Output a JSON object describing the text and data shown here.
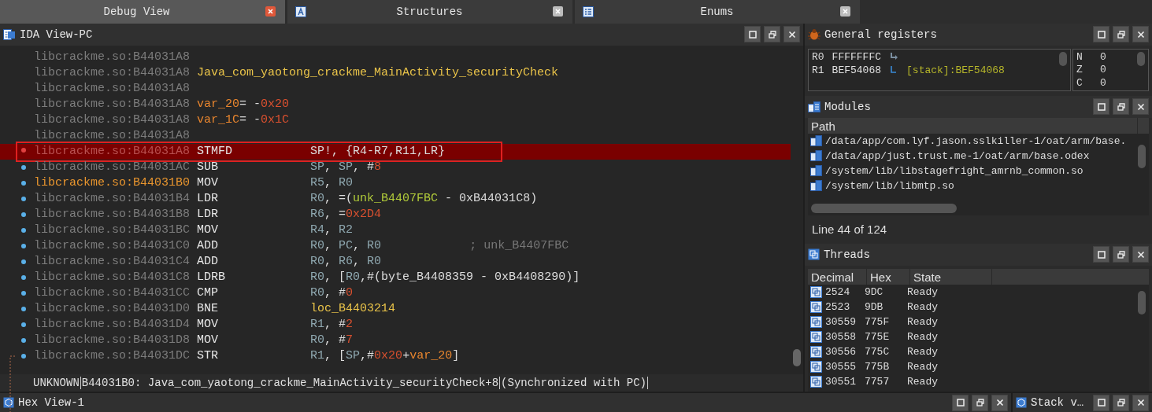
{
  "tabs": [
    {
      "label": "Debug View",
      "selected": true
    },
    {
      "label": "Structures",
      "selected": false
    },
    {
      "label": "Enums",
      "selected": false
    }
  ],
  "ida_view": {
    "title": "IDA View-PC",
    "lines": [
      {
        "address": "libcrackme.so:B44031A8",
        "is_label": false,
        "dot": false,
        "breakpoint": false,
        "highlighted": false,
        "boxed": false
      },
      {
        "address": "libcrackme.so:B44031A8",
        "is_label": false,
        "dot": false,
        "breakpoint": false,
        "highlighted": false,
        "boxed": false,
        "operands": [
          {
            "t": "Java_com_yaotong_crackme_MainActivity_securityCheck",
            "kind": "func"
          }
        ]
      },
      {
        "address": "libcrackme.so:B44031A8",
        "is_label": false,
        "dot": false,
        "breakpoint": false,
        "highlighted": false,
        "boxed": false
      },
      {
        "address": "libcrackme.so:B44031A8",
        "is_label": false,
        "dot": false,
        "breakpoint": false,
        "highlighted": false,
        "boxed": false,
        "operands": [
          {
            "t": "var_20",
            "kind": "var"
          },
          {
            "t": "= -",
            "kind": "punct"
          },
          {
            "t": "0x20",
            "kind": "num"
          }
        ]
      },
      {
        "address": "libcrackme.so:B44031A8",
        "is_label": false,
        "dot": false,
        "breakpoint": false,
        "highlighted": false,
        "boxed": false,
        "operands": [
          {
            "t": "var_1C",
            "kind": "var"
          },
          {
            "t": "= -",
            "kind": "punct"
          },
          {
            "t": "0x1C",
            "kind": "num"
          }
        ]
      },
      {
        "address": "libcrackme.so:B44031A8",
        "is_label": false,
        "dot": false,
        "breakpoint": false,
        "highlighted": false,
        "boxed": false
      },
      {
        "address": "libcrackme.so:B44031A8",
        "is_label": false,
        "dot": false,
        "breakpoint": true,
        "highlighted": true,
        "boxed": true,
        "mnemonic": "STMFD",
        "operands": [
          {
            "t": "SP!, {R4-R7,R11,LR}",
            "kind": "punct"
          }
        ]
      },
      {
        "address": "libcrackme.so:B44031AC",
        "is_label": false,
        "dot": true,
        "breakpoint": false,
        "highlighted": false,
        "boxed": false,
        "mnemonic": "SUB",
        "operands": [
          {
            "t": "SP",
            "kind": "reg"
          },
          {
            "t": ", ",
            "kind": "punct"
          },
          {
            "t": "SP",
            "kind": "reg"
          },
          {
            "t": ", #",
            "kind": "punct"
          },
          {
            "t": "8",
            "kind": "num"
          }
        ]
      },
      {
        "address": "libcrackme.so:B44031B0",
        "is_label": true,
        "dot": true,
        "breakpoint": false,
        "highlighted": false,
        "boxed": false,
        "mnemonic": "MOV",
        "operands": [
          {
            "t": "R5",
            "kind": "reg"
          },
          {
            "t": ", ",
            "kind": "punct"
          },
          {
            "t": "R0",
            "kind": "reg"
          }
        ]
      },
      {
        "address": "libcrackme.so:B44031B4",
        "is_label": false,
        "dot": true,
        "breakpoint": false,
        "highlighted": false,
        "boxed": false,
        "mnemonic": "LDR",
        "operands": [
          {
            "t": "R0",
            "kind": "reg"
          },
          {
            "t": ", =(",
            "kind": "punct"
          },
          {
            "t": "unk_B4407FBC",
            "kind": "sym"
          },
          {
            "t": " - 0xB44031C8)",
            "kind": "punct"
          }
        ]
      },
      {
        "address": "libcrackme.so:B44031B8",
        "is_label": false,
        "dot": true,
        "breakpoint": false,
        "highlighted": false,
        "boxed": false,
        "mnemonic": "LDR",
        "operands": [
          {
            "t": "R6",
            "kind": "reg"
          },
          {
            "t": ", =",
            "kind": "punct"
          },
          {
            "t": "0x2D4",
            "kind": "num"
          }
        ]
      },
      {
        "address": "libcrackme.so:B44031BC",
        "is_label": false,
        "dot": true,
        "breakpoint": false,
        "highlighted": false,
        "boxed": false,
        "mnemonic": "MOV",
        "operands": [
          {
            "t": "R4",
            "kind": "reg"
          },
          {
            "t": ", ",
            "kind": "punct"
          },
          {
            "t": "R2",
            "kind": "reg"
          }
        ]
      },
      {
        "address": "libcrackme.so:B44031C0",
        "is_label": false,
        "dot": true,
        "breakpoint": false,
        "highlighted": false,
        "boxed": false,
        "mnemonic": "ADD",
        "operands": [
          {
            "t": "R0",
            "kind": "reg"
          },
          {
            "t": ", ",
            "kind": "punct"
          },
          {
            "t": "PC",
            "kind": "reg"
          },
          {
            "t": ", ",
            "kind": "punct"
          },
          {
            "t": "R0",
            "kind": "reg"
          }
        ],
        "comment": "; unk_B4407FBC"
      },
      {
        "address": "libcrackme.so:B44031C4",
        "is_label": false,
        "dot": true,
        "breakpoint": false,
        "highlighted": false,
        "boxed": false,
        "mnemonic": "ADD",
        "operands": [
          {
            "t": "R0",
            "kind": "reg"
          },
          {
            "t": ", ",
            "kind": "punct"
          },
          {
            "t": "R6",
            "kind": "reg"
          },
          {
            "t": ", ",
            "kind": "punct"
          },
          {
            "t": "R0",
            "kind": "reg"
          }
        ]
      },
      {
        "address": "libcrackme.so:B44031C8",
        "is_label": false,
        "dot": true,
        "breakpoint": false,
        "highlighted": false,
        "boxed": false,
        "mnemonic": "LDRB",
        "operands": [
          {
            "t": "R0",
            "kind": "reg"
          },
          {
            "t": ", [",
            "kind": "punct"
          },
          {
            "t": "R0",
            "kind": "reg"
          },
          {
            "t": ",#(byte_B4408359 - 0xB4408290)]",
            "kind": "punct"
          }
        ]
      },
      {
        "address": "libcrackme.so:B44031CC",
        "is_label": false,
        "dot": true,
        "breakpoint": false,
        "highlighted": false,
        "boxed": false,
        "mnemonic": "CMP",
        "operands": [
          {
            "t": "R0",
            "kind": "reg"
          },
          {
            "t": ", #",
            "kind": "punct"
          },
          {
            "t": "0",
            "kind": "num"
          }
        ]
      },
      {
        "address": "libcrackme.so:B44031D0",
        "is_label": false,
        "dot": true,
        "breakpoint": false,
        "highlighted": false,
        "boxed": false,
        "mnemonic": "BNE",
        "operands": [
          {
            "t": "loc_B4403214",
            "kind": "func"
          }
        ]
      },
      {
        "address": "libcrackme.so:B44031D4",
        "is_label": false,
        "dot": true,
        "breakpoint": false,
        "highlighted": false,
        "boxed": false,
        "mnemonic": "MOV",
        "operands": [
          {
            "t": "R1",
            "kind": "reg"
          },
          {
            "t": ", #",
            "kind": "punct"
          },
          {
            "t": "2",
            "kind": "num"
          }
        ]
      },
      {
        "address": "libcrackme.so:B44031D8",
        "is_label": false,
        "dot": true,
        "breakpoint": false,
        "highlighted": false,
        "boxed": false,
        "mnemonic": "MOV",
        "operands": [
          {
            "t": "R0",
            "kind": "reg"
          },
          {
            "t": ", #",
            "kind": "punct"
          },
          {
            "t": "7",
            "kind": "num"
          }
        ]
      },
      {
        "address": "libcrackme.so:B44031DC",
        "is_label": false,
        "dot": true,
        "breakpoint": false,
        "highlighted": false,
        "boxed": false,
        "mnemonic": "STR",
        "operands": [
          {
            "t": "R1",
            "kind": "reg"
          },
          {
            "t": ", [",
            "kind": "punct"
          },
          {
            "t": "SP",
            "kind": "reg"
          },
          {
            "t": ",#",
            "kind": "punct"
          },
          {
            "t": "0x20",
            "kind": "num"
          },
          {
            "t": "+",
            "kind": "punct"
          },
          {
            "t": "var_20",
            "kind": "var"
          },
          {
            "t": "]",
            "kind": "punct"
          }
        ]
      }
    ],
    "status": [
      "UNKNOWN",
      "B44031B0: Java_com_yaotong_crackme_MainActivity_securityCheck+8",
      "(Synchronized with PC)"
    ]
  },
  "registers": {
    "title": "General registers",
    "rows": [
      {
        "name": "R0",
        "value": "FFFFFFFC"
      },
      {
        "name": "R1",
        "value": "BEF54068",
        "note": "[stack]:BEF54068"
      }
    ],
    "flags": [
      {
        "name": "N",
        "value": "0"
      },
      {
        "name": "Z",
        "value": "0"
      },
      {
        "name": "C",
        "value": "0"
      }
    ]
  },
  "modules": {
    "title": "Modules",
    "columns": [
      "Path"
    ],
    "rows": [
      "/data/app/com.lyf.jason.sslkiller-1/oat/arm/base.",
      "/data/app/just.trust.me-1/oat/arm/base.odex",
      "/system/lib/libstagefright_amrnb_common.so",
      "/system/lib/libmtp.so"
    ],
    "status": "Line 44 of 124"
  },
  "threads": {
    "title": "Threads",
    "columns": [
      "Decimal",
      "Hex",
      "State"
    ],
    "rows": [
      [
        "2524",
        "9DC",
        "Ready"
      ],
      [
        "2523",
        "9DB",
        "Ready"
      ],
      [
        "30559",
        "775F",
        "Ready"
      ],
      [
        "30558",
        "775E",
        "Ready"
      ],
      [
        "30556",
        "775C",
        "Ready"
      ],
      [
        "30555",
        "775B",
        "Ready"
      ],
      [
        "30551",
        "7757",
        "Ready"
      ]
    ]
  },
  "bottom": {
    "left_title": "Hex View-1",
    "right_title": "Stack v…"
  }
}
